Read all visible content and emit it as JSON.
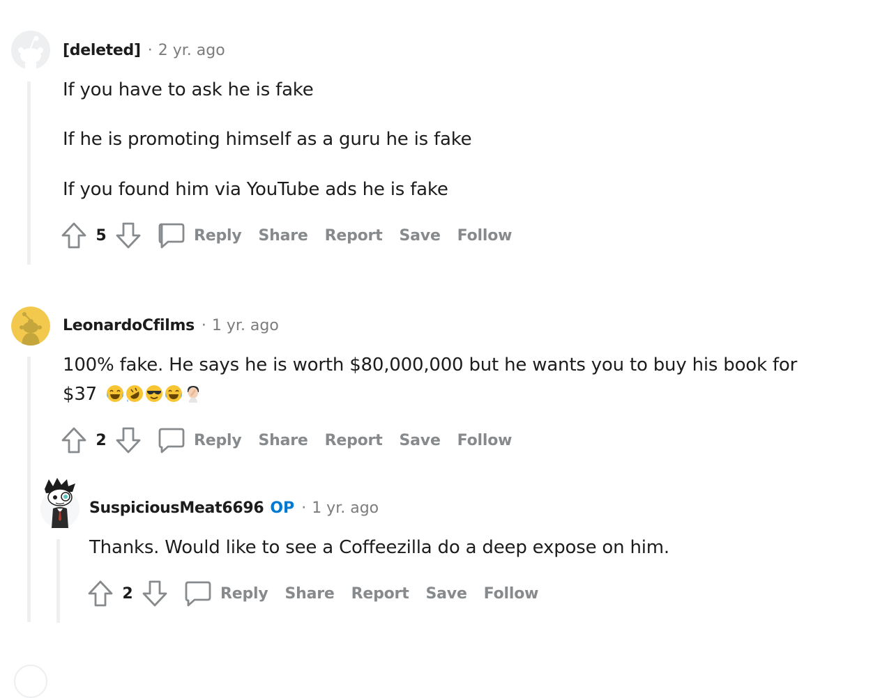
{
  "comments": [
    {
      "author": "[deleted]",
      "time": "2 yr. ago",
      "lines": [
        "If you have to ask he is fake",
        "If he is promoting himself as a guru he is fake",
        "If you found him via YouTube ads he is fake"
      ],
      "score": "5"
    },
    {
      "author": "LeonardoCfilms",
      "time": "1 yr. ago",
      "lines": [
        "100% fake. He says he is worth $80,000,000 but he wants you to buy his book for",
        "$37"
      ],
      "emojis": [
        "face-with-tears-of-joy",
        "rolling-on-floor-laughing",
        "smiling-face-with-sunglasses",
        "face-with-tears-of-joy",
        "man-facepalming"
      ],
      "score": "2"
    },
    {
      "author": "SuspiciousMeat6696",
      "flair": "OP",
      "time": "1 yr. ago",
      "lines": [
        "Thanks. Would like to see a Coffeezilla do a deep expose on him."
      ],
      "score": "2"
    }
  ],
  "actions": {
    "reply": "Reply",
    "share": "Share",
    "report": "Report",
    "save": "Save",
    "follow": "Follow"
  },
  "separator": "·",
  "colors": {
    "text": "#1c1c1c",
    "muted": "#878a8c",
    "op": "#0079d3",
    "thread": "#edeff1",
    "avatar_yellow": "#f2c94c"
  }
}
